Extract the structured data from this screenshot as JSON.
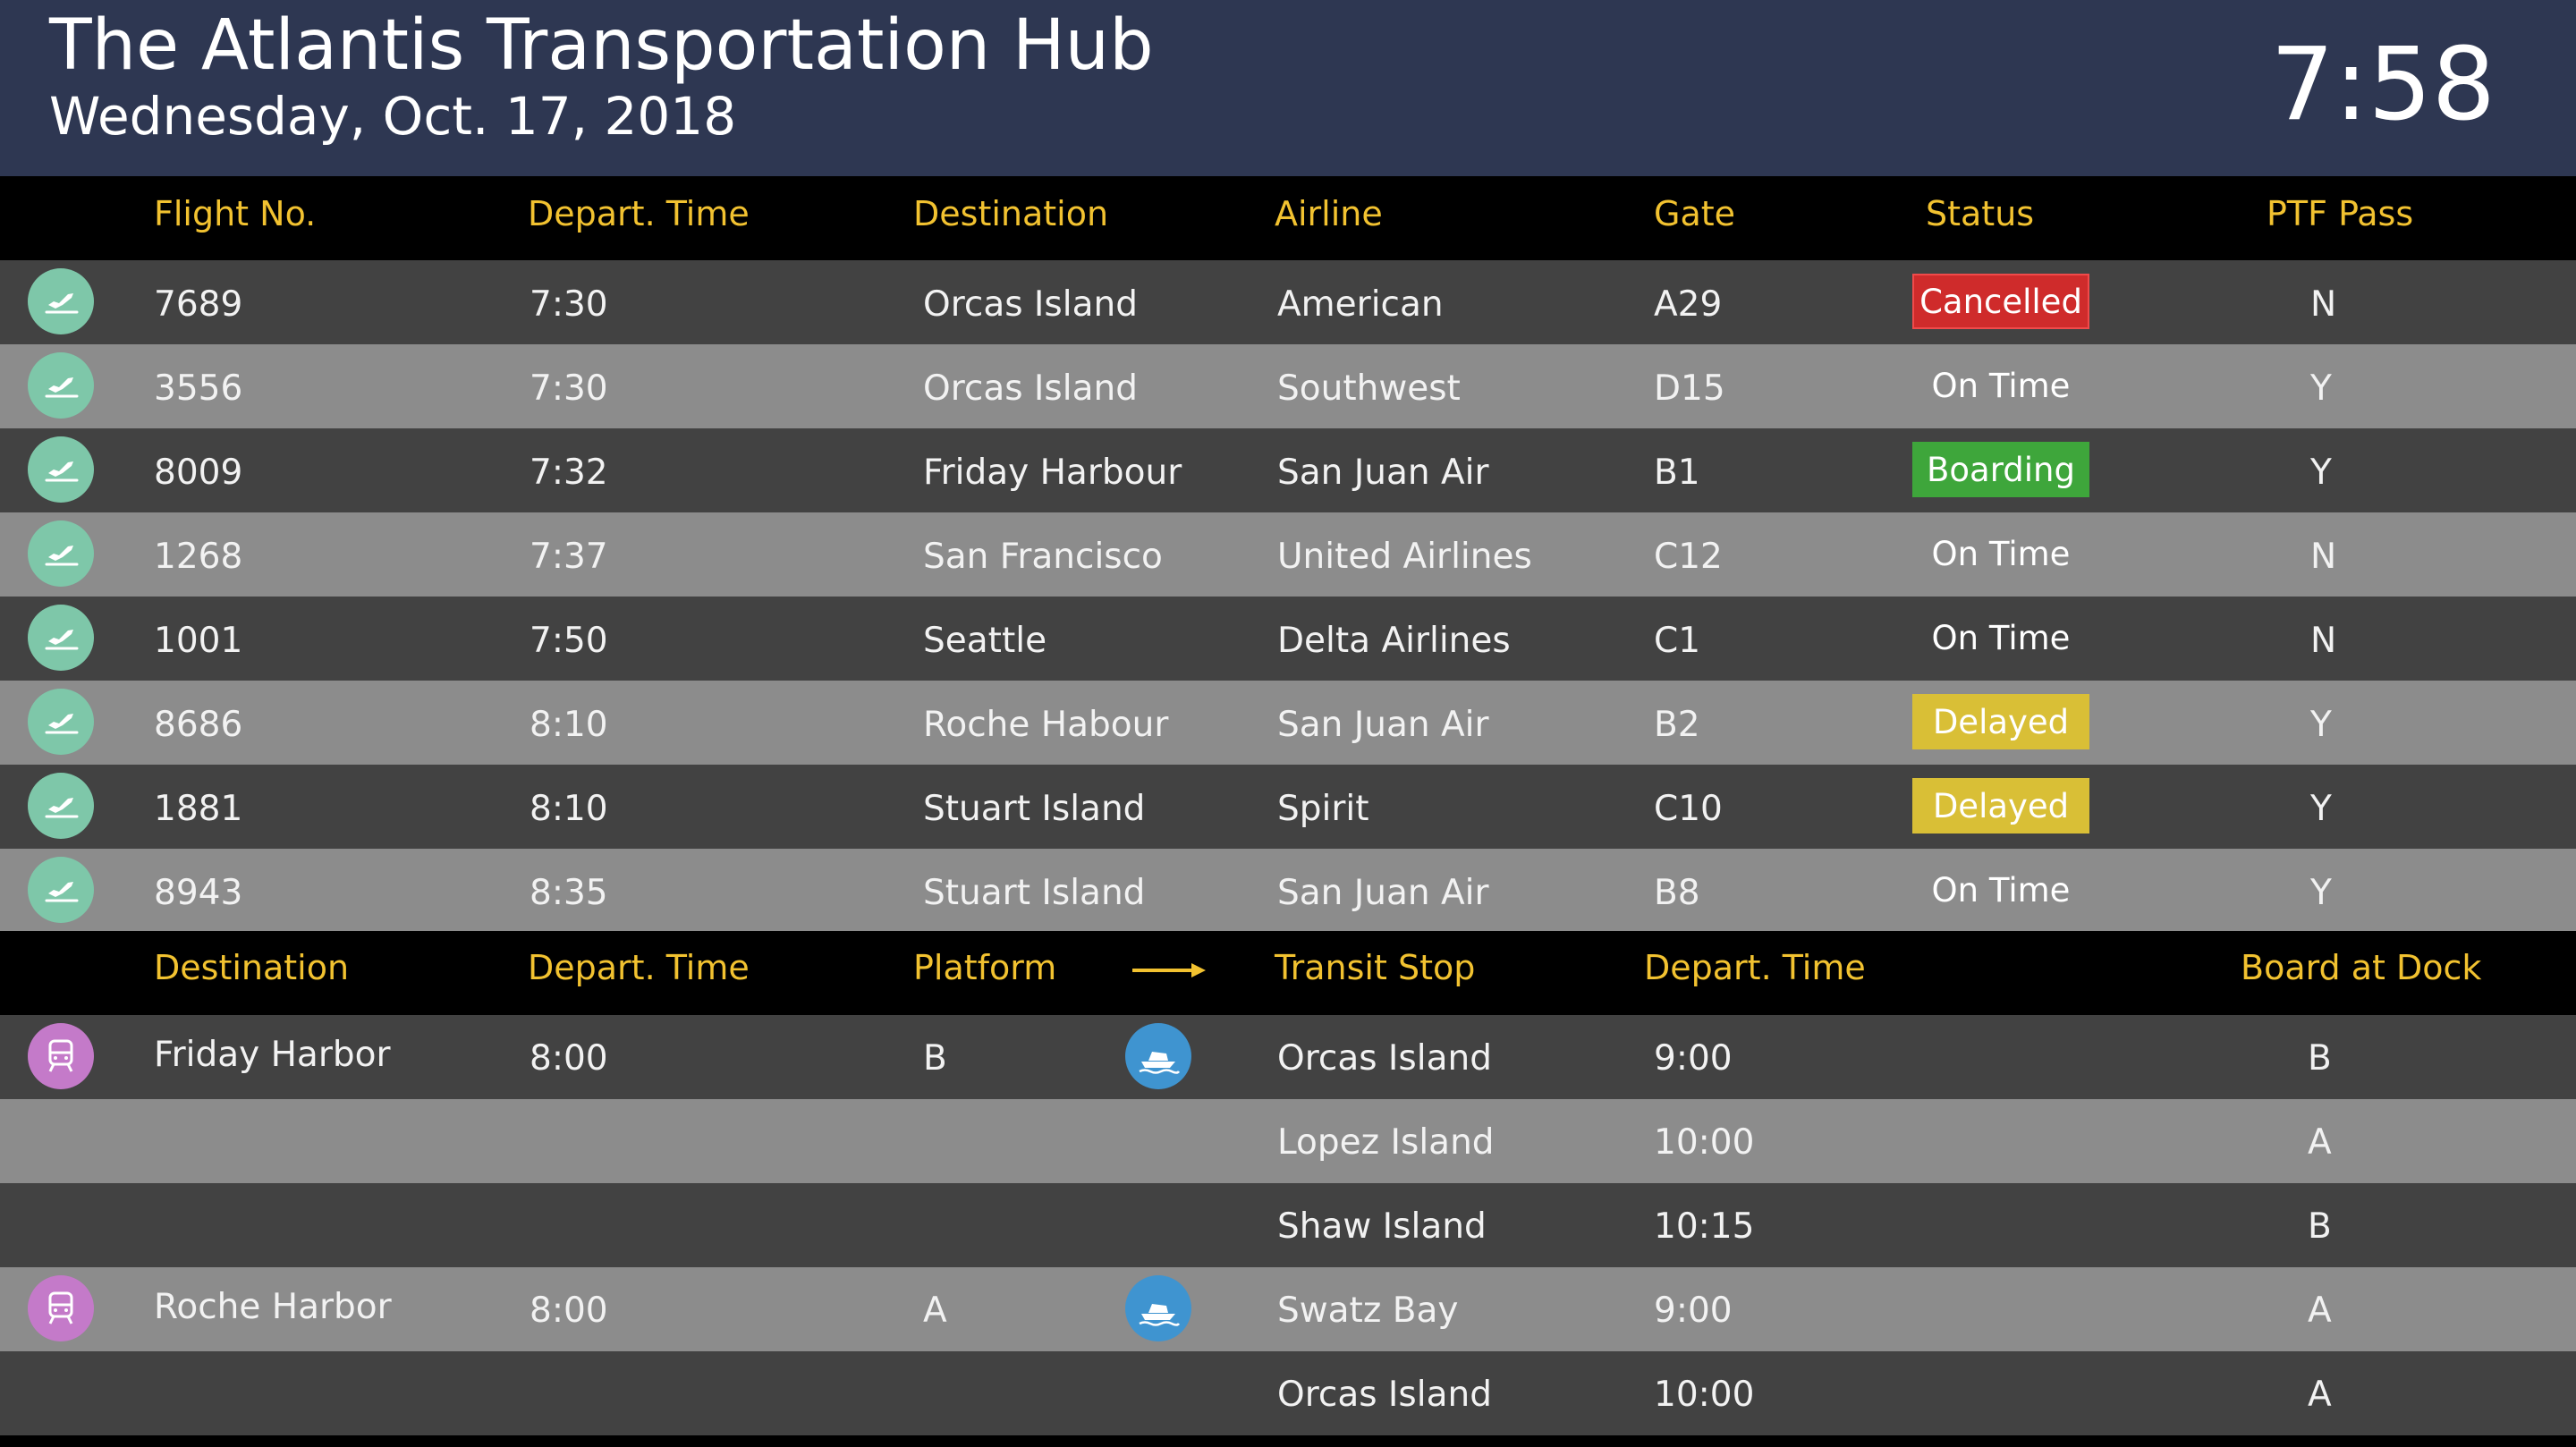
{
  "header": {
    "title": "The Atlantis Transportation Hub",
    "date": "Wednesday, Oct. 17, 2018",
    "clock": "7:58"
  },
  "flight_headers": {
    "flight_no": "Flight No.",
    "depart_time": "Depart. Time",
    "destination": "Destination",
    "airline": "Airline",
    "gate": "Gate",
    "status": "Status",
    "ptf_pass": "PTF Pass"
  },
  "flights": [
    {
      "icon": "airplane-takeoff-icon",
      "flight": "7689",
      "time": "7:30",
      "destination": "Orcas Island",
      "airline": "American",
      "gate": "A29",
      "status": "Cancelled",
      "status_style": "cancelled",
      "ptf": "N"
    },
    {
      "icon": "airplane-takeoff-icon",
      "flight": "3556",
      "time": "7:30",
      "destination": "Orcas Island",
      "airline": "Southwest",
      "gate": "D15",
      "status": "On Time",
      "status_style": "ontime",
      "ptf": "Y"
    },
    {
      "icon": "airplane-takeoff-icon",
      "flight": "8009",
      "time": "7:32",
      "destination": "Friday Harbour",
      "airline": "San Juan Air",
      "gate": "B1",
      "status": "Boarding",
      "status_style": "boarding",
      "ptf": "Y"
    },
    {
      "icon": "airplane-takeoff-icon",
      "flight": "1268",
      "time": "7:37",
      "destination": "San Francisco",
      "airline": "United Airlines",
      "gate": "C12",
      "status": "On Time",
      "status_style": "ontime",
      "ptf": "N"
    },
    {
      "icon": "airplane-takeoff-icon",
      "flight": "1001",
      "time": "7:50",
      "destination": "Seattle",
      "airline": "Delta Airlines",
      "gate": "C1",
      "status": "On Time",
      "status_style": "ontime",
      "ptf": "N"
    },
    {
      "icon": "airplane-takeoff-icon",
      "flight": "8686",
      "time": "8:10",
      "destination": "Roche Habour",
      "airline": "San Juan Air",
      "gate": "B2",
      "status": "Delayed",
      "status_style": "delayed",
      "ptf": "Y"
    },
    {
      "icon": "airplane-takeoff-icon",
      "flight": "1881",
      "time": "8:10",
      "destination": "Stuart Island",
      "airline": "Spirit",
      "gate": "C10",
      "status": "Delayed",
      "status_style": "delayed",
      "ptf": "Y"
    },
    {
      "icon": "airplane-takeoff-icon",
      "flight": "8943",
      "time": "8:35",
      "destination": "Stuart Island",
      "airline": "San Juan Air",
      "gate": "B8",
      "status": "On Time",
      "status_style": "ontime",
      "ptf": "Y"
    }
  ],
  "transit_headers": {
    "destination": "Destination",
    "depart_time": "Depart. Time",
    "platform": "Platform",
    "arrow_icon": "right-arrow-icon",
    "transit_stop": "Transit Stop",
    "depart_time_2": "Depart. Time",
    "board_at_dock": "Board at Dock"
  },
  "transit": [
    {
      "train_icon": "train-icon",
      "destination": "Friday Harbor",
      "time": "8:00",
      "platform": "B",
      "ferry_icon": "ferry-icon",
      "stop": "Orcas Island",
      "stop_time": "9:00",
      "dock": "B"
    },
    {
      "train_icon": "",
      "destination": "",
      "time": "",
      "platform": "",
      "ferry_icon": "",
      "stop": "Lopez Island",
      "stop_time": "10:00",
      "dock": "A"
    },
    {
      "train_icon": "",
      "destination": "",
      "time": "",
      "platform": "",
      "ferry_icon": "",
      "stop": "Shaw Island",
      "stop_time": "10:15",
      "dock": "B"
    },
    {
      "train_icon": "train-icon",
      "destination": "Roche Harbor",
      "time": "8:00",
      "platform": "A",
      "ferry_icon": "ferry-icon",
      "stop": "Swatz Bay",
      "stop_time": "9:00",
      "dock": "A"
    },
    {
      "train_icon": "",
      "destination": "",
      "time": "",
      "platform": "",
      "ferry_icon": "",
      "stop": "Orcas Island",
      "stop_time": "10:00",
      "dock": "A"
    }
  ],
  "colors": {
    "header_bg": "#2e3752",
    "heading_text": "#f2c230",
    "row_dark": "#424242",
    "row_light": "#8c8c8c",
    "cancelled": "#cf2b2b",
    "boarding": "#3ea63b",
    "delayed": "#d9bf36",
    "plane_icon_bg": "#7ec7a9",
    "train_icon_bg": "#c47ac9",
    "ferry_icon_bg": "#3f94d0"
  }
}
